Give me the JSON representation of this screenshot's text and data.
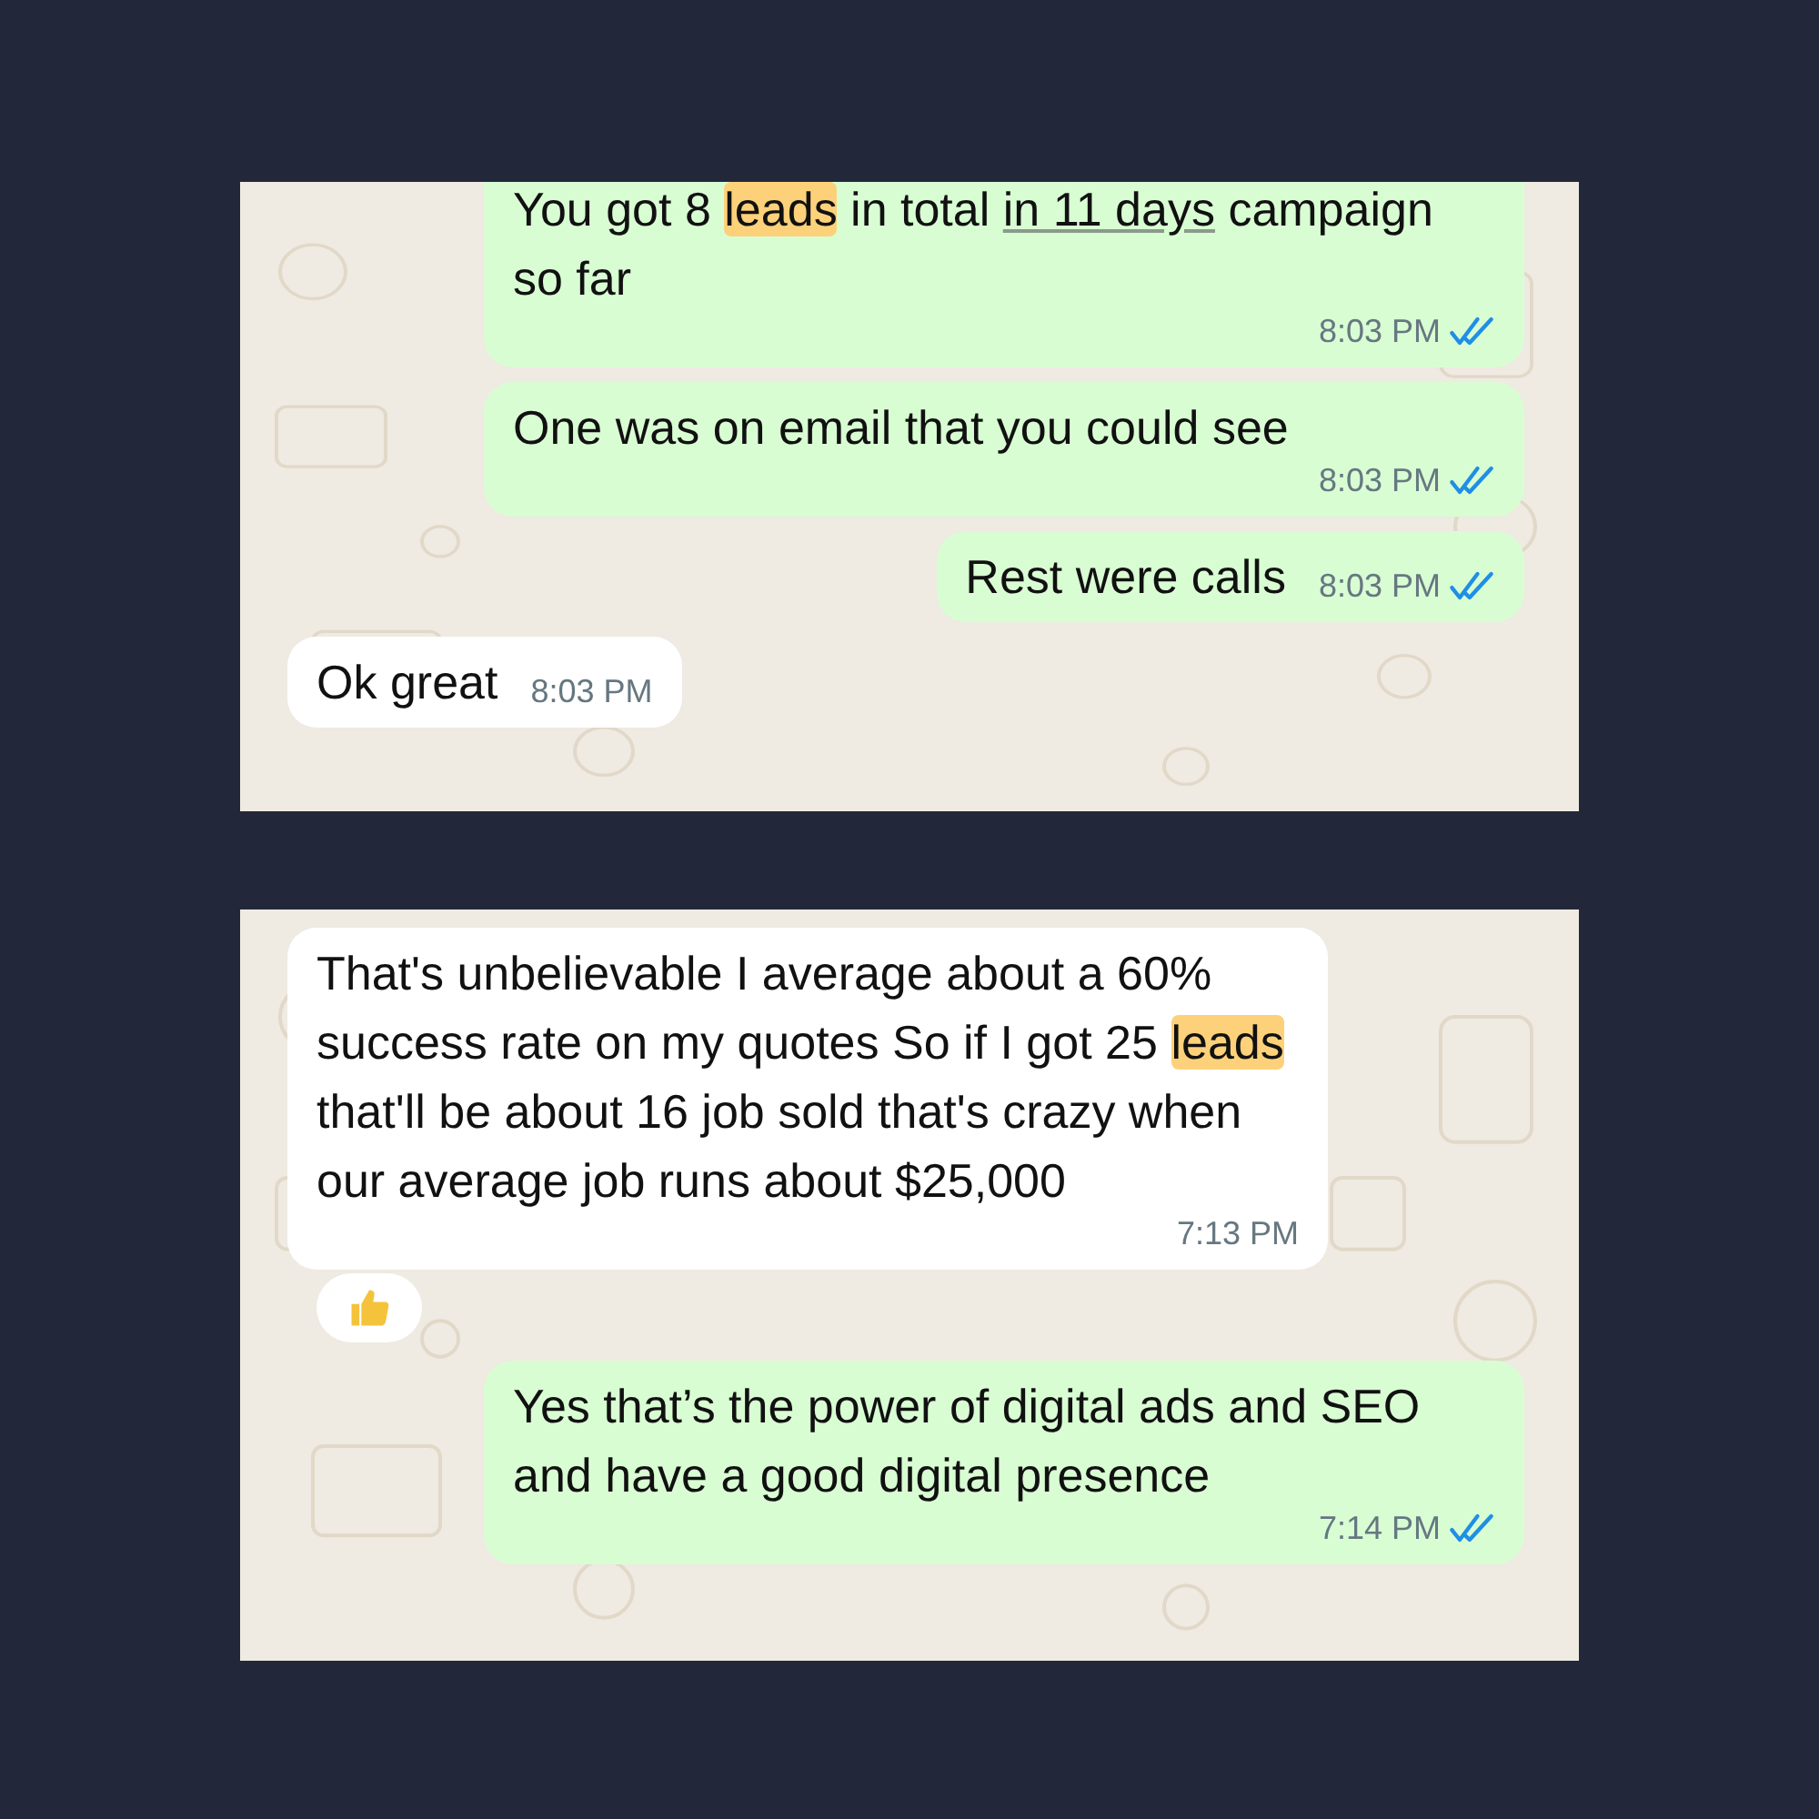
{
  "panels": [
    {
      "messages": [
        {
          "kind": "outgoing",
          "segments": [
            {
              "text": "You got 8 "
            },
            {
              "text": "leads",
              "highlight": true
            },
            {
              "text": " in total "
            },
            {
              "text": "in 11 days",
              "underline": true
            },
            {
              "text": " campaign so far"
            }
          ],
          "time": "8:03 PM",
          "read": true,
          "cut_top": true
        },
        {
          "kind": "outgoing",
          "segments": [
            {
              "text": "One was on email that you could see"
            }
          ],
          "time": "8:03 PM",
          "read": true
        },
        {
          "kind": "outgoing",
          "segments": [
            {
              "text": "Rest were calls"
            }
          ],
          "time": "8:03 PM",
          "read": true
        },
        {
          "kind": "incoming",
          "segments": [
            {
              "text": "Ok great"
            }
          ],
          "time": "8:03 PM"
        }
      ]
    },
    {
      "messages": [
        {
          "kind": "incoming",
          "segments": [
            {
              "text": "That's unbelievable I average about a 60% success rate on my quotes So if I got 25 "
            },
            {
              "text": "leads",
              "highlight": true
            },
            {
              "text": " that'll be about 16 job sold that's crazy when our average job runs about $25,000"
            }
          ],
          "time": "7:13 PM",
          "reaction": true
        },
        {
          "kind": "outgoing",
          "segments": [
            {
              "text": "Yes that’s the power of digital ads and SEO and have a good digital presence"
            }
          ],
          "time": "7:14 PM",
          "read": true
        }
      ]
    }
  ]
}
